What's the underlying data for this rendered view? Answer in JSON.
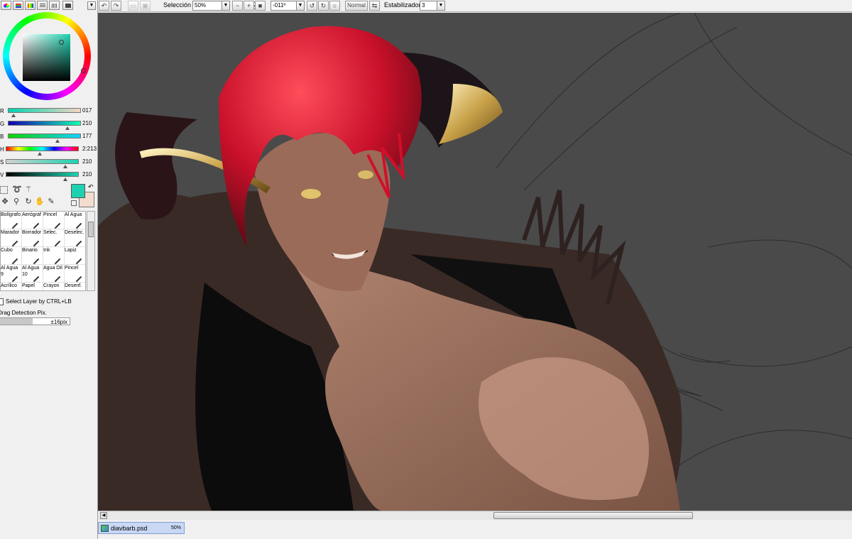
{
  "toolbar": {
    "selection_label": "Selección",
    "zoom": "50%",
    "rotation": "-011º",
    "blend_mode": "Normal",
    "stabilizer_label": "Estabilizador",
    "stabilizer_value": "3"
  },
  "color_panel": {
    "current_color": "#1ED2B1",
    "secondary_color": "#F2DCCD",
    "sliders": [
      {
        "label": "R",
        "value": "017"
      },
      {
        "label": "G",
        "value": "210"
      },
      {
        "label": "B",
        "value": "177"
      },
      {
        "label": "H",
        "value": "2:213"
      },
      {
        "label": "S",
        "value": "210"
      },
      {
        "label": "V",
        "value": "210"
      }
    ]
  },
  "brushes": [
    {
      "label": "Bolígrafo"
    },
    {
      "label": "Aerógraf"
    },
    {
      "label": "Pincel"
    },
    {
      "label": "Al Agua"
    },
    {
      "label": "Marador"
    },
    {
      "label": "Borrador"
    },
    {
      "label": "Selec."
    },
    {
      "label": "Deselec."
    },
    {
      "label": "Cubo"
    },
    {
      "label": "Binario"
    },
    {
      "label": "Ink"
    },
    {
      "label": "Lapiz"
    },
    {
      "label": "Al Agua"
    },
    {
      "label": "Al Agua"
    },
    {
      "label": "Agua Oil"
    },
    {
      "label": "Pincel"
    },
    {
      "label": "Acrílico"
    },
    {
      "label": "Papel"
    },
    {
      "label": "Crayon"
    },
    {
      "label": "Desenf."
    }
  ],
  "brush_sub": {
    "b12": "9",
    "b13": "10"
  },
  "options": {
    "select_layer": "Select Layer by CTRL+LB",
    "drag_detection": "Drag Detection Pix.",
    "drag_value": "±16pix"
  },
  "document": {
    "filename": "diavbarb.psd",
    "zoom": "50%"
  }
}
